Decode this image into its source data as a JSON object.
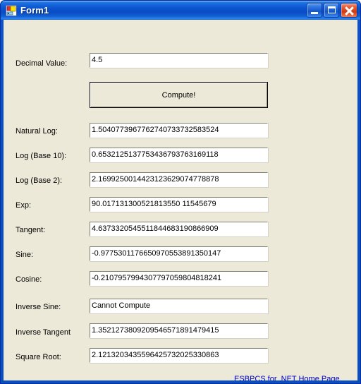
{
  "window": {
    "title": "Form1",
    "icon": "form-designer-icon",
    "caption_buttons": [
      {
        "name": "minimize",
        "glyph": "_"
      },
      {
        "name": "maximize",
        "glyph": "□"
      },
      {
        "name": "close",
        "glyph": "✕"
      }
    ],
    "colors": {
      "titlebar_blue": "#0a4ec2",
      "client_background": "#ece9d8",
      "link_blue": "#0000cc",
      "close_red": "#cf3a12"
    }
  },
  "input": {
    "label": "Decimal Value:",
    "value": "4.5",
    "placeholder": ""
  },
  "compute_button": {
    "label": "Compute!"
  },
  "results": [
    {
      "label": "Natural Log:",
      "value": "1.5040773967762740733732583524"
    },
    {
      "label": "Log (Base 10):",
      "value": "0.6532125137753436793763169118"
    },
    {
      "label": "Log (Base 2):",
      "value": "2.1699250014423123629074778878"
    },
    {
      "label": "Exp:",
      "value": "90.017131300521813550 11545679"
    },
    {
      "label": "Tangent:",
      "value": "4.6373320545511844683190866909"
    },
    {
      "label": "Sine:",
      "value": "-0.9775301176650970553891350147"
    },
    {
      "label": "Cosine:",
      "value": "-0.2107957994307797059804818241"
    },
    {
      "label": "Inverse Sine:",
      "value": "Cannot Compute"
    },
    {
      "label": "Inverse Tangent",
      "value": "1.3521273809209546571891479415"
    },
    {
      "label": "Square Root:",
      "value": "2.1213203435596425732025330863"
    }
  ],
  "footer_link": {
    "label": "ESBPCS for .NET Home Page"
  }
}
